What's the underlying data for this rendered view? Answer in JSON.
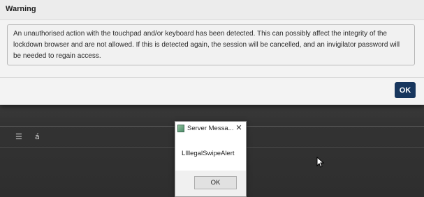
{
  "warning": {
    "title": "Warning",
    "message": "An unauthorised action with the touchpad and/or keyboard has been detected. This can possibly affect the integrity of the lockdown browser and are not allowed. If this is detected again, the session will be cancelled, and an invigilator password will be needed to regain access.",
    "ok_label": "OK",
    "ok_color": "#17365d"
  },
  "server_dialog": {
    "title": "Server Messa...",
    "close_glyph": "✕",
    "message": "LIllegalSwipeAlert",
    "ok_label": "OK",
    "app_icon": "app-icon"
  },
  "background": {
    "toolbar_list_icon": "☰",
    "toolbar_glyph": "á"
  },
  "cursor": {
    "icon": "mouse-pointer-icon"
  }
}
